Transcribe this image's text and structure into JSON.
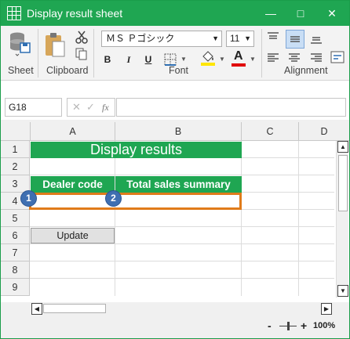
{
  "window": {
    "title": "Display result sheet",
    "controls": {
      "minimize": "—",
      "maximize": "□",
      "close": "✕"
    }
  },
  "ribbon": {
    "groups": [
      {
        "label": "Sheet"
      },
      {
        "label": "Clipboard"
      },
      {
        "label": "Font"
      },
      {
        "label": "Alignment"
      }
    ],
    "font_name": "ＭＳ Ｐゴシック",
    "font_size": "11",
    "bold": "B",
    "italic": "I",
    "underline": "U",
    "font_color_letter": "A",
    "accent_green": "#1fa652",
    "highlight_yellow": "#ffe600",
    "font_color_red": "#e00000"
  },
  "formula_bar": {
    "name_box": "G18",
    "cancel_glyph": "✕",
    "enter_glyph": "✓",
    "fx_glyph": "fx",
    "value": ""
  },
  "grid": {
    "columns": [
      "A",
      "B",
      "C",
      "D"
    ],
    "rows": [
      "1",
      "2",
      "3",
      "4",
      "5",
      "6",
      "7",
      "8",
      "9"
    ],
    "title": "Display results",
    "header_dealer": "Dealer code",
    "header_sales": "Total sales summary",
    "marker_1": "1",
    "marker_2": "2",
    "update_button": "Update",
    "highlight_color": "#e07b1a",
    "marker_color": "#3f6fb1"
  },
  "status": {
    "zoom_minus": "-",
    "zoom_plus": "+",
    "zoom": "100%"
  }
}
